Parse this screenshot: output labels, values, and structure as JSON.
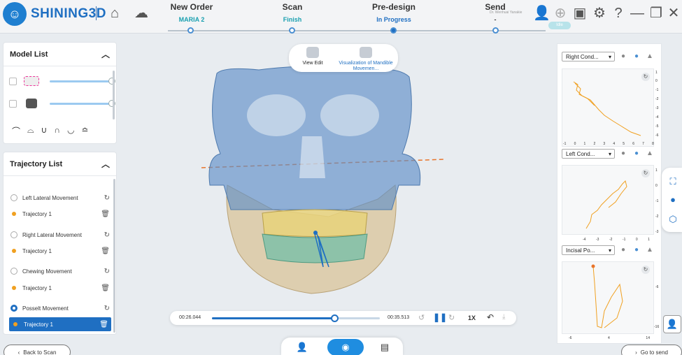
{
  "app": {
    "brand": "SHINING3D"
  },
  "header": {
    "user_tiny": "Dr. Wenhuai Yanakie",
    "badge": "Idle"
  },
  "steps": [
    {
      "title": "New Order",
      "status": "MARIA 2"
    },
    {
      "title": "Scan",
      "status": "Finish"
    },
    {
      "title": "Pre-design",
      "status": "In Progress"
    },
    {
      "title": "Send",
      "status": "-"
    }
  ],
  "model_list": {
    "title": "Model List"
  },
  "trajectory_list": {
    "title": "Trajectory List",
    "groups": [
      {
        "label": "Left Lateral Movement",
        "trajectory": "Trajectory 1"
      },
      {
        "label": "Right Lateral Movement",
        "trajectory": "Trajectory 1"
      },
      {
        "label": "Chewing Movement",
        "trajectory": "Trajectory 1"
      },
      {
        "label": "Posselt Movement",
        "trajectory": "Trajectory 1"
      }
    ]
  },
  "view_toolbar": {
    "view_edit": "View Edit",
    "visualization": "Visualization of Mandible Movemen..."
  },
  "player": {
    "current_time": "00:26.044",
    "total_time": "00:35.513",
    "speed": "1X",
    "progress": 0.73
  },
  "buttons": {
    "back": "Back to Scan",
    "next": "Go to send"
  },
  "right_panel": {
    "plots": [
      {
        "select": "Right Cond...",
        "yticks": [
          "1",
          "0",
          "-1",
          "-2",
          "-3",
          "-4",
          "-5",
          "-6"
        ],
        "xticks": [
          "-1",
          "0",
          "1",
          "2",
          "3",
          "4",
          "5",
          "6",
          "7",
          "8"
        ]
      },
      {
        "select": "Left Cond...",
        "yticks": [
          "1",
          "0",
          "-1",
          "-2",
          "-3"
        ],
        "xticks": [
          "-4",
          "-3",
          "-2",
          "-1",
          "0",
          "1"
        ]
      },
      {
        "select": "Incisal Po...",
        "yticks": [
          "-6",
          "-16"
        ],
        "xticks": [
          "-6",
          "4",
          "14"
        ]
      }
    ]
  },
  "colors": {
    "accent": "#1f6fc2",
    "teal": "#1aa0b0",
    "trajectory_orange": "#f0a020",
    "skull_blue": "#5f8fc8",
    "jaw_tan": "#d9c49a"
  }
}
